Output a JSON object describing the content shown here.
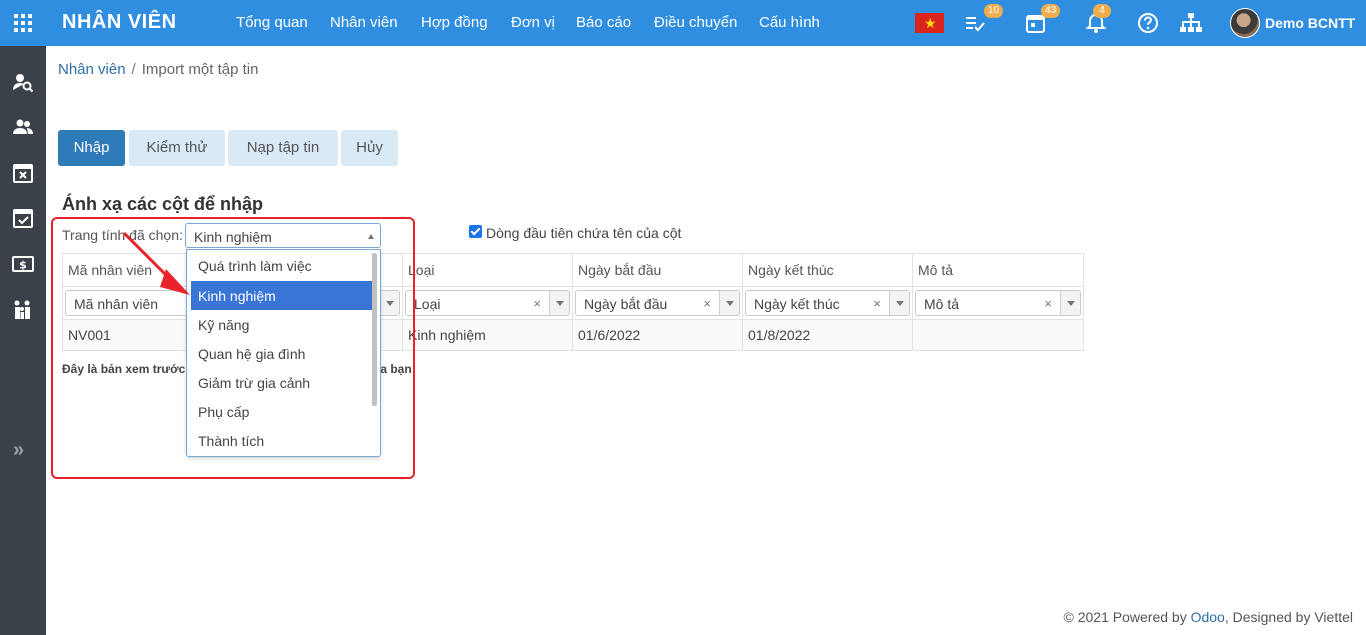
{
  "topbar": {
    "brand": "NHÂN VIÊN",
    "nav": [
      "Tổng quan",
      "Nhân viên",
      "Hợp đồng",
      "Đơn vị",
      "Báo cáo",
      "Điều chuyển",
      "Cấu hình"
    ],
    "badges": {
      "tasks": "10",
      "calendar": "43",
      "notifications": "4"
    },
    "user_name": "Demo BCNTT",
    "accent_color": "#2f8ee0",
    "badge_color": "#f0ad4e"
  },
  "sidebar": {
    "icons": [
      "user-search-icon",
      "users-icon",
      "calendar-x-icon",
      "calendar-check-icon",
      "money-icon",
      "family-icon"
    ],
    "collapse": "»"
  },
  "breadcrumb": {
    "parent": "Nhân viên",
    "separator": "/",
    "current": "Import một tập tin"
  },
  "actions": {
    "import": "Nhập",
    "test": "Kiểm thử",
    "load_file": "Nạp tập tin",
    "cancel": "Hủy"
  },
  "mapping": {
    "title": "Ánh xạ các cột để nhập",
    "sheet_label": "Trang tính đã chọn:",
    "sheet_value": "Kinh nghiệm",
    "first_row_header_label": "Dòng đầu tiên chứa tên của cột",
    "first_row_header_checked": true
  },
  "table": {
    "headers": [
      "Mã nhân viên",
      "",
      "Loại",
      "Ngày bắt đầu",
      "Ngày kết thúc",
      "Mô tả"
    ],
    "field_selects": [
      "Mã nhân viên",
      "",
      "Loại",
      "Ngày bắt đầu",
      "Ngày kết thúc",
      "Mô tả"
    ],
    "clear_glyph": "×",
    "rows": [
      [
        "NV001",
        "",
        "Kinh nghiệm",
        "01/6/2022",
        "01/8/2022",
        ""
      ]
    ]
  },
  "preview_note": {
    "visible_start": "Đây là bản xem trước",
    "visible_end": "ủa bạn"
  },
  "dropdown": {
    "options": [
      "Quá trình làm việc",
      "Kinh nghiệm",
      "Kỹ năng",
      "Quan hệ gia đình",
      "Giảm trừ gia cảnh",
      "Phụ cấp",
      "Thành tích"
    ],
    "selected": "Kinh nghiệm",
    "highlight_color": "#3875d7"
  },
  "annotation": {
    "box_color": "#e8232b"
  },
  "footer": {
    "prefix": "© 2021 Powered by",
    "odoo": "Odoo",
    "suffix": ", Designed by Viettel"
  }
}
